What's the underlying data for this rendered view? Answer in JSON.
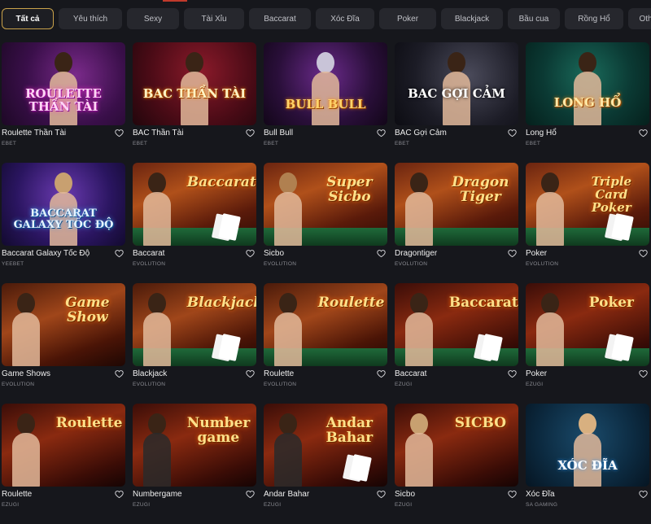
{
  "tabs": [
    {
      "label": "Tất cả",
      "active": true
    },
    {
      "label": "Yêu thích"
    },
    {
      "label": "Sexy"
    },
    {
      "label": "Tài Xỉu"
    },
    {
      "label": "Baccarat"
    },
    {
      "label": "Xóc Đĩa"
    },
    {
      "label": "Poker"
    },
    {
      "label": "Blackjack"
    },
    {
      "label": "Bầu cua"
    },
    {
      "label": "Rồng Hổ"
    },
    {
      "label": "Other"
    }
  ],
  "games": [
    {
      "name": "Roulette Thần Tài",
      "provider": "EBET",
      "logo": "ROULETTE THẦN TÀI"
    },
    {
      "name": "BAC Thần Tài",
      "provider": "EBET",
      "logo": "BAC THẦN TÀI"
    },
    {
      "name": "Bull Bull",
      "provider": "EBET",
      "logo": "BULL BULL"
    },
    {
      "name": "BAC Gợi Cảm",
      "provider": "EBET",
      "logo": "BAC GỢI CẢM"
    },
    {
      "name": "Long Hổ",
      "provider": "EBET",
      "logo": "LONG HỔ"
    },
    {
      "name": "Baccarat Galaxy Tốc Độ",
      "provider": "YEEBET",
      "logo": "BACCARAT GALAXY TỐC ĐỘ"
    },
    {
      "name": "Baccarat",
      "provider": "EVOLUTION",
      "logo": "Baccarat"
    },
    {
      "name": "Sicbo",
      "provider": "EVOLUTION",
      "logo": "Super Sicbo"
    },
    {
      "name": "Dragontiger",
      "provider": "EVOLUTION",
      "logo": "Dragon Tiger"
    },
    {
      "name": "Poker",
      "provider": "EVOLUTION",
      "logo": "Triple Card Poker"
    },
    {
      "name": "Game Shows",
      "provider": "EVOLUTION",
      "logo": "Game Show"
    },
    {
      "name": "Blackjack",
      "provider": "EVOLUTION",
      "logo": "Blackjack"
    },
    {
      "name": "Roulette",
      "provider": "EVOLUTION",
      "logo": "Roulette"
    },
    {
      "name": "Baccarat",
      "provider": "EZUGI",
      "logo": "Baccarat"
    },
    {
      "name": "Poker",
      "provider": "EZUGI",
      "logo": "Poker"
    },
    {
      "name": "Roulette",
      "provider": "EZUGI",
      "logo": "Roulette"
    },
    {
      "name": "Numbergame",
      "provider": "EZUGI",
      "logo": "Number game"
    },
    {
      "name": "Andar Bahar",
      "provider": "EZUGI",
      "logo": "Andar Bahar"
    },
    {
      "name": "Sicbo",
      "provider": "EZUGI",
      "logo": "SICBO"
    },
    {
      "name": "Xóc Đĩa",
      "provider": "SA GAMING",
      "logo": "XÓC ĐĨA"
    }
  ],
  "icons": {
    "favorite": "heart-icon"
  },
  "colors": {
    "active_tab_border": "#c9a24a",
    "background": "#16171c"
  }
}
